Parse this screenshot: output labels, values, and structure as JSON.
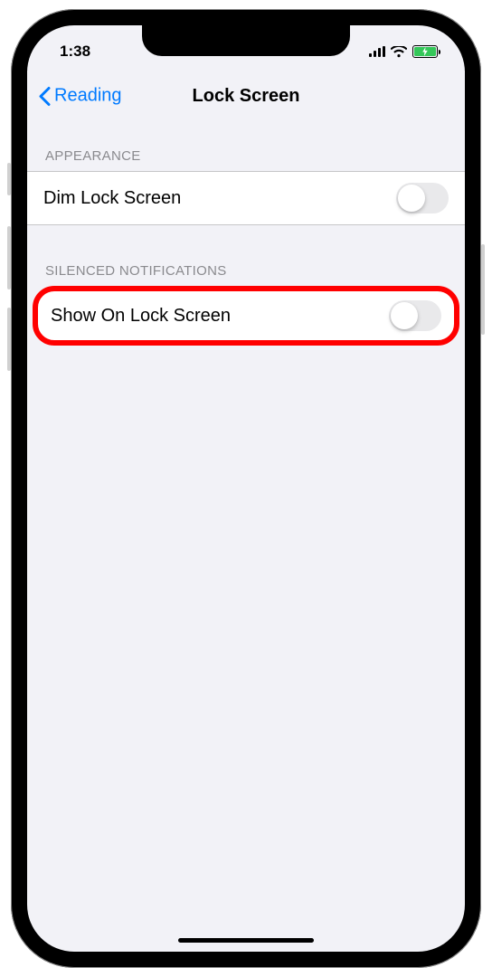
{
  "status": {
    "time": "1:38"
  },
  "nav": {
    "back_label": "Reading",
    "title": "Lock Screen"
  },
  "sections": {
    "appearance": {
      "header": "APPEARANCE",
      "items": {
        "dim": {
          "label": "Dim Lock Screen",
          "on": false
        }
      }
    },
    "silenced": {
      "header": "SILENCED NOTIFICATIONS",
      "items": {
        "show": {
          "label": "Show On Lock Screen",
          "on": false
        }
      }
    }
  }
}
